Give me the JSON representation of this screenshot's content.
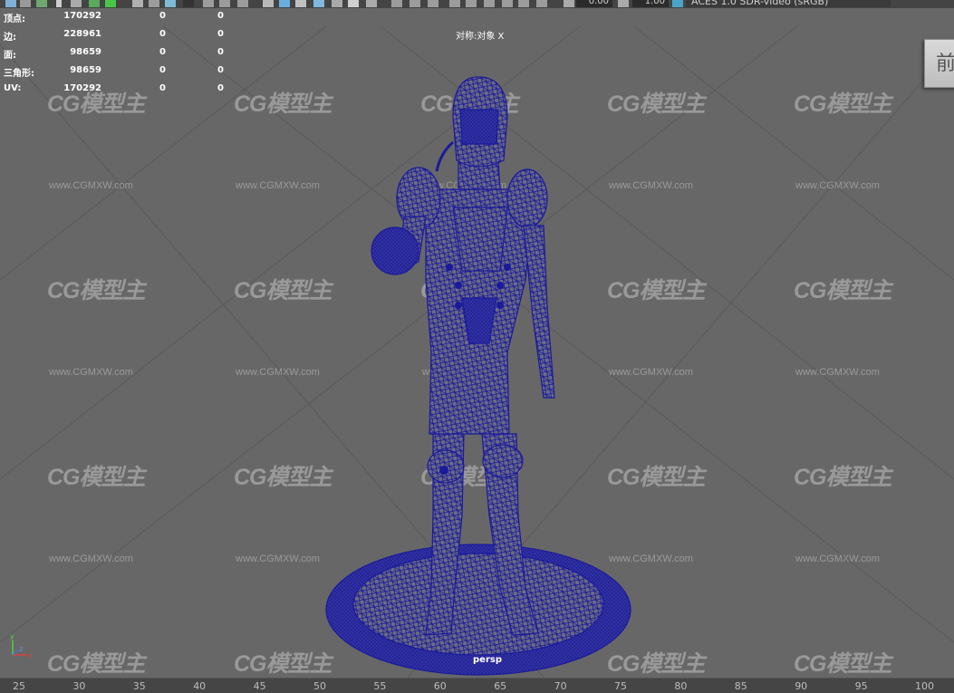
{
  "toolbar": {
    "exposure_value": "0.00",
    "gamma_value": "1.00",
    "color_space": "ACES 1.0 SDR-video (sRGB)"
  },
  "hud_stats": [
    {
      "label": "顶点:",
      "value": "170292",
      "c2": "0",
      "c3": "0"
    },
    {
      "label": "边:",
      "value": "228961",
      "c2": "0",
      "c3": "0"
    },
    {
      "label": "面:",
      "value": "98659",
      "c2": "0",
      "c3": "0"
    },
    {
      "label": "三角形:",
      "value": "98659",
      "c2": "0",
      "c3": "0"
    },
    {
      "label": "UV:",
      "value": "170292",
      "c2": "0",
      "c3": "0"
    }
  ],
  "viewport": {
    "symmetry_label": "对称:对象 X",
    "camera_name": "persp",
    "viewcube_face": "前"
  },
  "watermark": {
    "logo_text": "CG模型主",
    "url_text": "www.CGMXW.com"
  },
  "axis_labels": {
    "y": "y",
    "z": "z",
    "x": "x"
  },
  "timeline_ticks": [
    "25",
    "30",
    "35",
    "40",
    "45",
    "50",
    "55",
    "60",
    "65",
    "70",
    "75",
    "80",
    "85",
    "90",
    "95",
    "100"
  ],
  "colors": {
    "viewport_bg": "#676767",
    "wire": "#1a1a9c",
    "toolbar_bg": "#444444"
  }
}
